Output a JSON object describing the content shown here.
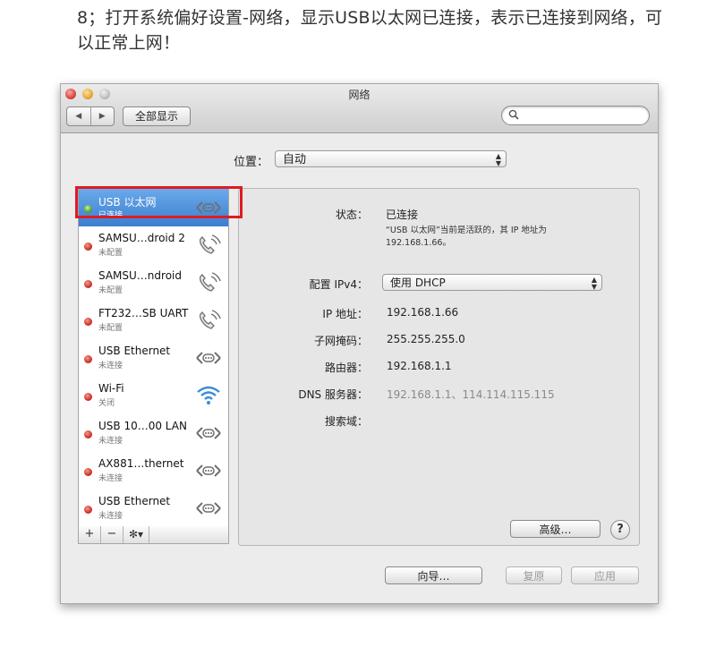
{
  "caption": "8；打开系统偏好设置-网络，显示USB以太网已连接，表示已连接到网络，可以正常上网！",
  "window": {
    "title": "网络",
    "nav_back_icon": "◀",
    "nav_forward_icon": "▶",
    "show_all_label": "全部显示",
    "search_placeholder": ""
  },
  "location": {
    "label": "位置：",
    "value": "自动"
  },
  "services": [
    {
      "name": "USB 以太网",
      "status": "已连接",
      "icon": "ethernet-icon",
      "state": "connected",
      "selected": true
    },
    {
      "name": "SAMSU…droid 2",
      "status": "未配置",
      "icon": "phone-icon",
      "state": "off"
    },
    {
      "name": "SAMSU…ndroid",
      "status": "未配置",
      "icon": "phone-icon",
      "state": "off"
    },
    {
      "name": "FT232…SB UART",
      "status": "未配置",
      "icon": "phone-icon",
      "state": "off"
    },
    {
      "name": "USB Ethernet",
      "status": "未连接",
      "icon": "ethernet-icon",
      "state": "off"
    },
    {
      "name": "Wi-Fi",
      "status": "关闭",
      "icon": "wifi-icon",
      "state": "off"
    },
    {
      "name": "USB 10…00 LAN",
      "status": "未连接",
      "icon": "ethernet-icon",
      "state": "off"
    },
    {
      "name": "AX881…thernet",
      "status": "未连接",
      "icon": "ethernet-icon",
      "state": "off"
    },
    {
      "name": "USB Ethernet",
      "status": "未连接",
      "icon": "ethernet-icon",
      "state": "off"
    }
  ],
  "sidebar_toolbar": {
    "add": "+",
    "remove": "−",
    "gear": "✻▾"
  },
  "detail": {
    "status_label": "状态：",
    "status_value": "已连接",
    "status_note_line1": "“USB 以太网”当前是活跃的，其 IP 地址为",
    "status_note_line2": "192.168.1.66。",
    "ipv4_label": "配置 IPv4：",
    "ipv4_value": "使用 DHCP",
    "ip_label": "IP 地址：",
    "ip_value": "192.168.1.66",
    "subnet_label": "子网掩码：",
    "subnet_value": "255.255.255.0",
    "router_label": "路由器：",
    "router_value": "192.168.1.1",
    "dns_label": "DNS 服务器：",
    "dns_value": "192.168.1.1、114.114.115.115",
    "search_domain_label": "搜索域：",
    "advanced_label": "高级…",
    "help_label": "?"
  },
  "footer": {
    "assist_label": "向导…",
    "revert_label": "复原",
    "apply_label": "应用"
  },
  "colors": {
    "selection": "#3a7fd0",
    "highlight_box": "#e01b22",
    "connected_dot": "#4ea221",
    "disconnected_dot": "#c92b22"
  }
}
